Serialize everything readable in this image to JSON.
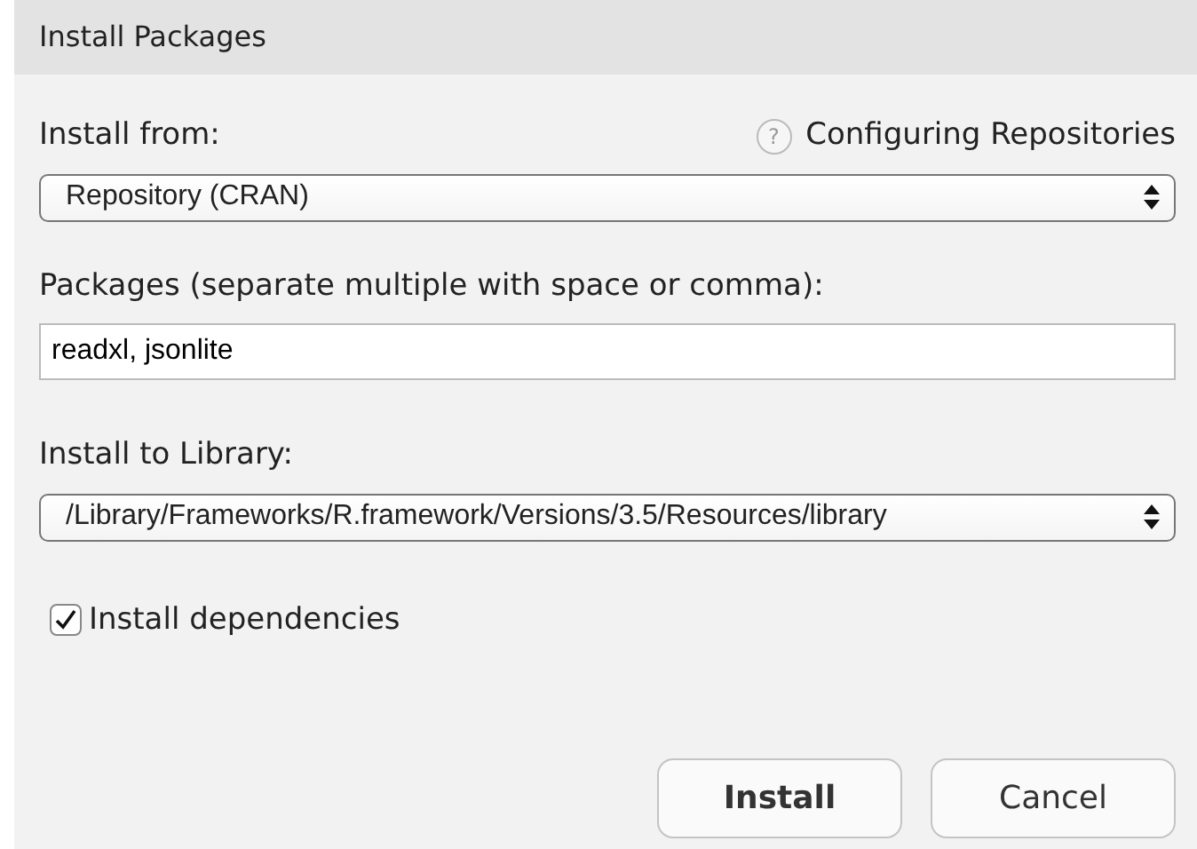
{
  "window": {
    "title": "Install Packages"
  },
  "install_from": {
    "label": "Install from:",
    "help_icon": "?",
    "help_link": "Configuring Repositories",
    "value": "Repository (CRAN)"
  },
  "packages": {
    "label": "Packages (separate multiple with space or comma):",
    "value": "readxl, jsonlite"
  },
  "library": {
    "label": "Install to Library:",
    "value": "/Library/Frameworks/R.framework/Versions/3.5/Resources/library"
  },
  "dependencies": {
    "label": "Install dependencies",
    "checked": true
  },
  "buttons": [
    {
      "label": "Install",
      "kind": "default"
    },
    {
      "label": "Cancel",
      "kind": "normal"
    }
  ]
}
